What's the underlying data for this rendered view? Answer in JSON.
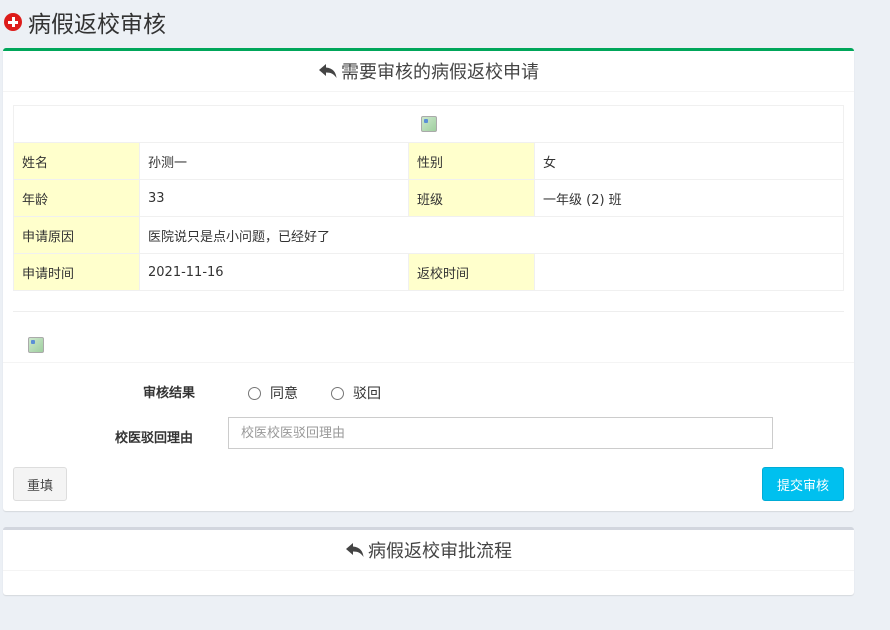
{
  "page": {
    "title": "病假返校审核"
  },
  "main_box": {
    "title": "需要审核的病假返校申请",
    "rows": {
      "name_label": "姓名",
      "name_value": "孙测一",
      "gender_label": "性别",
      "gender_value": "女",
      "age_label": "年龄",
      "age_value": "33",
      "class_label": "班级",
      "class_value": "一年级 (2) 班",
      "reason_label": "申请原因",
      "reason_value": "医院说只是点小问题，已经好了",
      "apply_time_label": "申请时间",
      "apply_time_value": "2021-11-16",
      "return_time_label": "返校时间",
      "return_time_value": ""
    }
  },
  "form": {
    "result_label": "审核结果",
    "option_agree": "同意",
    "option_reject": "驳回",
    "reason_label": "校医驳回理由",
    "reason_placeholder": "校医校医驳回理由",
    "reset_label": "重填",
    "submit_label": "提交审核"
  },
  "flow_box": {
    "title": "病假返校审批流程"
  },
  "colors": {
    "primary_border": "#00a65a",
    "label_bg": "#ffffcc",
    "submit_bg": "#00c0ef",
    "icon_red": "#dd1c1a"
  },
  "icons": [
    "plus-circle-icon",
    "reply-icon",
    "broken-image-icon"
  ]
}
